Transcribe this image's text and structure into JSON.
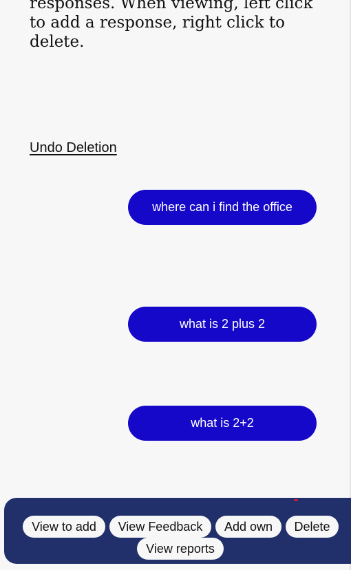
{
  "instructions": {
    "text": "responses. When viewing, left click to add a response, right click to delete."
  },
  "undo": {
    "label": "Undo Deletion"
  },
  "questions": [
    "where can i find the office",
    "what is 2 plus 2",
    "what is 2+2"
  ],
  "toolbar": {
    "view_to_add": "View to add",
    "view_feedback": "View Feedback",
    "add_own": "Add own",
    "delete": "Delete",
    "view_reports": "View reports"
  },
  "colors": {
    "question_bubble": "#1508c8",
    "toolbar_bg": "#21306b",
    "page_bg": "#f8f7f8"
  }
}
